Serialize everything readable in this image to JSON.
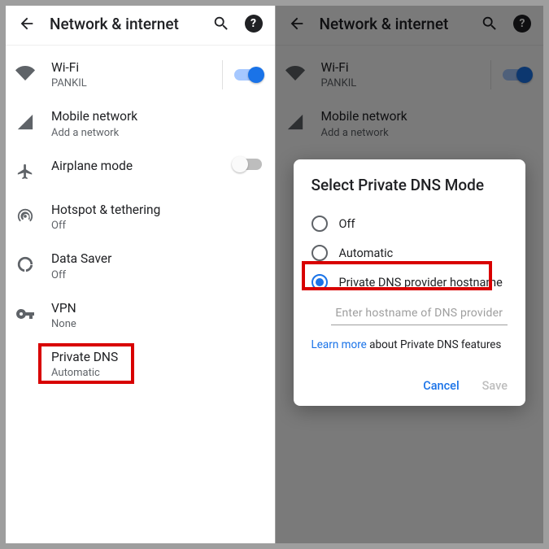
{
  "header": {
    "title": "Network & internet"
  },
  "rows": {
    "wifi": {
      "label": "Wi-Fi",
      "sub": "PANKIL"
    },
    "mobile": {
      "label": "Mobile network",
      "sub": "Add a network"
    },
    "airplane": {
      "label": "Airplane mode"
    },
    "hotspot": {
      "label": "Hotspot & tethering",
      "sub": "Off"
    },
    "datasaver": {
      "label": "Data Saver",
      "sub": "Off"
    },
    "vpn": {
      "label": "VPN",
      "sub": "None"
    },
    "pdns": {
      "label": "Private DNS",
      "sub": "Automatic"
    }
  },
  "dialog": {
    "title": "Select Private DNS Mode",
    "opt_off": "Off",
    "opt_auto": "Automatic",
    "opt_host": "Private DNS provider hostname",
    "placeholder": "Enter hostname of DNS provider",
    "learn_link": "Learn more",
    "learn_rest": " about Private DNS features",
    "cancel": "Cancel",
    "save": "Save"
  }
}
